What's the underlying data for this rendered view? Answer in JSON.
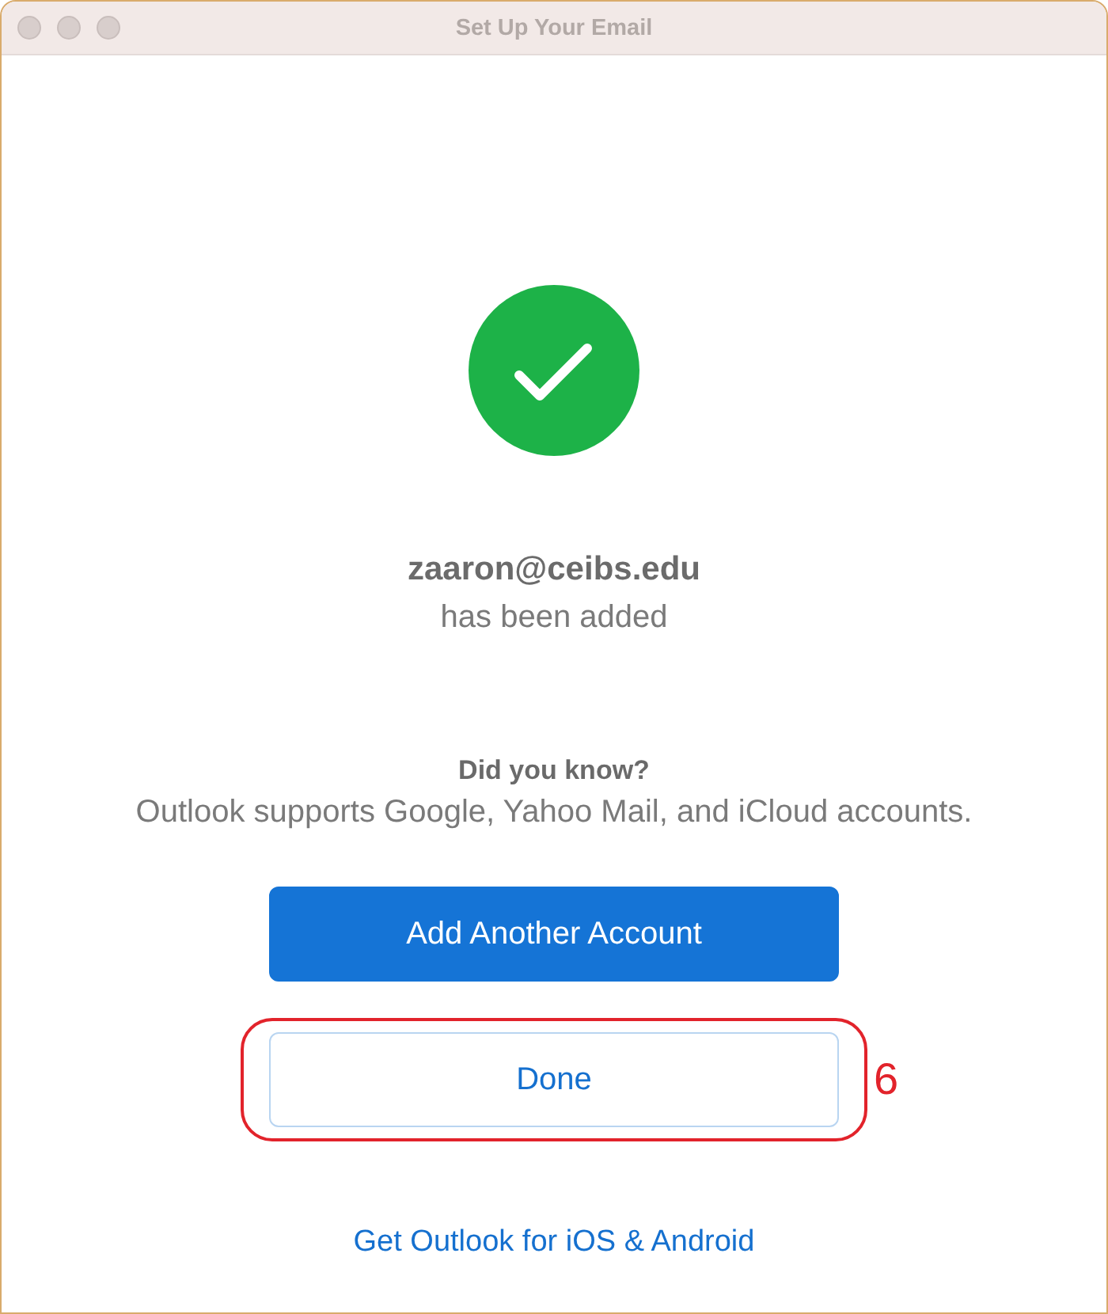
{
  "window": {
    "title": "Set Up Your Email"
  },
  "account": {
    "email": "zaaron@ceibs.edu",
    "message": "has been added"
  },
  "tip": {
    "heading": "Did you know?",
    "text": "Outlook supports Google, Yahoo Mail, and iCloud accounts."
  },
  "buttons": [
    {
      "label": "Add Another Account",
      "kind": "primary"
    },
    {
      "label": "Done",
      "kind": "secondary",
      "callout": "6"
    }
  ],
  "link": "Get Outlook for iOS & Android"
}
